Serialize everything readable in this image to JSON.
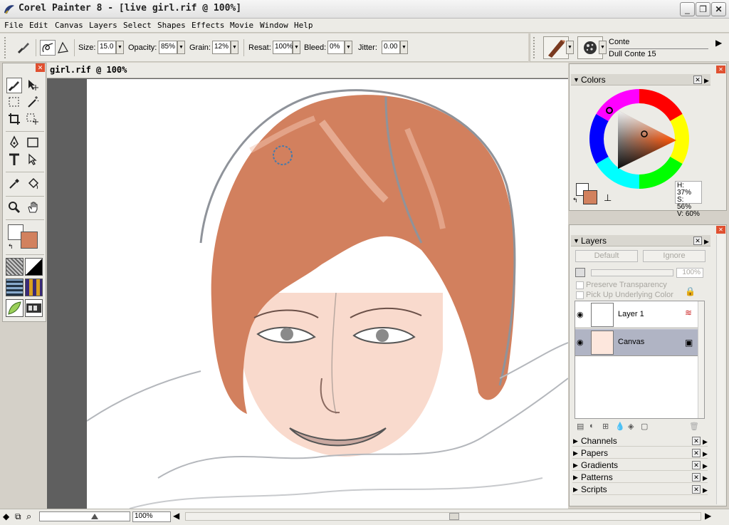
{
  "window": {
    "title": "Corel Painter 8 - [live girl.rif @ 100%]",
    "controls": [
      "_",
      "❐",
      "✕"
    ]
  },
  "menu": [
    "File",
    "Edit",
    "Canvas",
    "Layers",
    "Select",
    "Shapes",
    "Effects",
    "Movie",
    "Window",
    "Help"
  ],
  "property_bar": {
    "size_label": "Size:",
    "size_value": "15.0",
    "opacity_label": "Opacity:",
    "opacity_value": "85%",
    "grain_label": "Grain:",
    "grain_value": "12%",
    "resat_label": "Resat:",
    "resat_value": "100%",
    "bleed_label": "Bleed:",
    "bleed_value": "0%",
    "jitter_label": "Jitter:",
    "jitter_value": "0.00"
  },
  "brush_selector": {
    "category": "Conte",
    "variant": "Dull Conte 15"
  },
  "document": {
    "title": "girl.rif @ 100%"
  },
  "status": {
    "zoom": "100%"
  },
  "colors_panel": {
    "title": "Colors",
    "h": "H: 37%",
    "s": "S: 56%",
    "v": "V: 60%",
    "primary_color": "#d2815e",
    "secondary_color": "#ffffff"
  },
  "layers_panel": {
    "title": "Layers",
    "composite_method": "Default",
    "composite_depth": "Ignore",
    "opacity": "100%",
    "preserve_transparency": "Preserve Transparency",
    "pick_up_underlying": "Pick Up Underlying Color",
    "layers": [
      {
        "name": "Layer 1",
        "selected": false
      },
      {
        "name": "Canvas",
        "selected": true
      }
    ]
  },
  "other_panels": [
    "Channels",
    "Papers",
    "Gradients",
    "Patterns",
    "Scripts"
  ]
}
